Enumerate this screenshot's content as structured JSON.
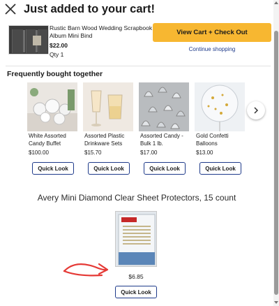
{
  "header": {
    "title": "Just added to your cart!"
  },
  "added_item": {
    "name": "Rustic Barn Wood Wedding Scrapbook Album Mini Bind",
    "price": "$22.00",
    "qty": "Qty 1"
  },
  "actions": {
    "view_cart": "View Cart + Check Out",
    "continue": "Continue shopping"
  },
  "fbt": {
    "title": "Frequently bought together",
    "items": [
      {
        "name": "White Assorted Candy Buffet",
        "price": "$100.00",
        "button": "Quick Look"
      },
      {
        "name": "Assorted Plastic Drinkware Sets",
        "price": "$15.70",
        "button": "Quick Look"
      },
      {
        "name": "Assorted Candy - Bulk 1 lb.",
        "price": "$17.00",
        "button": "Quick Look"
      },
      {
        "name": "Gold Confetti Balloons",
        "price": "$13.00",
        "button": "Quick Look"
      }
    ]
  },
  "recommendation": {
    "title": "Avery Mini Diamond Clear Sheet Protectors, 15 count",
    "price": "$6.85",
    "button": "Quick Look",
    "brand": "AVERY",
    "package_label": "Sheet Protectors"
  },
  "colors": {
    "accent": "#f7b731",
    "link": "#1e3a8a",
    "annotation": "#e53935"
  }
}
